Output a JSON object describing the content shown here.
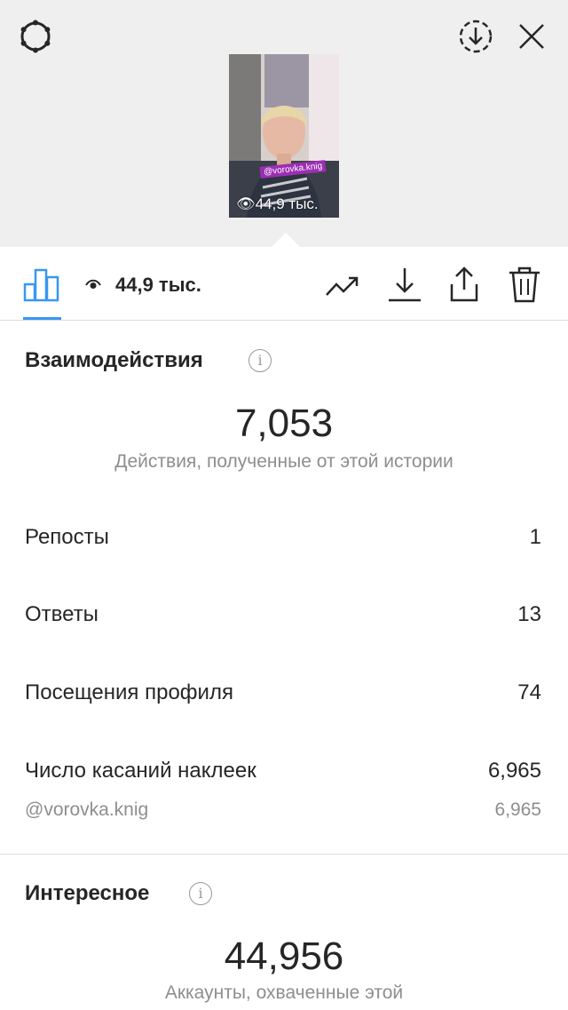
{
  "header": {
    "settings_icon": "gear-icon",
    "download_icon": "download-circle-icon",
    "close_icon": "close-icon"
  },
  "story_thumb": {
    "tag": "@vorovka.knig",
    "views": "44,9 тыс."
  },
  "toolbar": {
    "views": "44,9 тыс.",
    "icons": [
      "bar-chart-icon",
      "eye-icon",
      "trend-icon",
      "download-icon",
      "share-icon",
      "trash-icon"
    ],
    "accent": "#3897f0"
  },
  "interactions": {
    "title": "Взаимодействия",
    "total": "7,053",
    "caption": "Действия, полученные от этой истории",
    "rows": [
      {
        "label": "Репосты",
        "value": "1"
      },
      {
        "label": "Ответы",
        "value": "13"
      },
      {
        "label": "Посещения профиля",
        "value": "74"
      },
      {
        "label": "Число касаний наклеек",
        "value": "6,965"
      }
    ],
    "sub_row": {
      "label": "@vorovka.knig",
      "value": "6,965"
    }
  },
  "discovery": {
    "title": "Интересное",
    "total": "44,956",
    "caption": "Аккаунты, охваченные этой"
  }
}
